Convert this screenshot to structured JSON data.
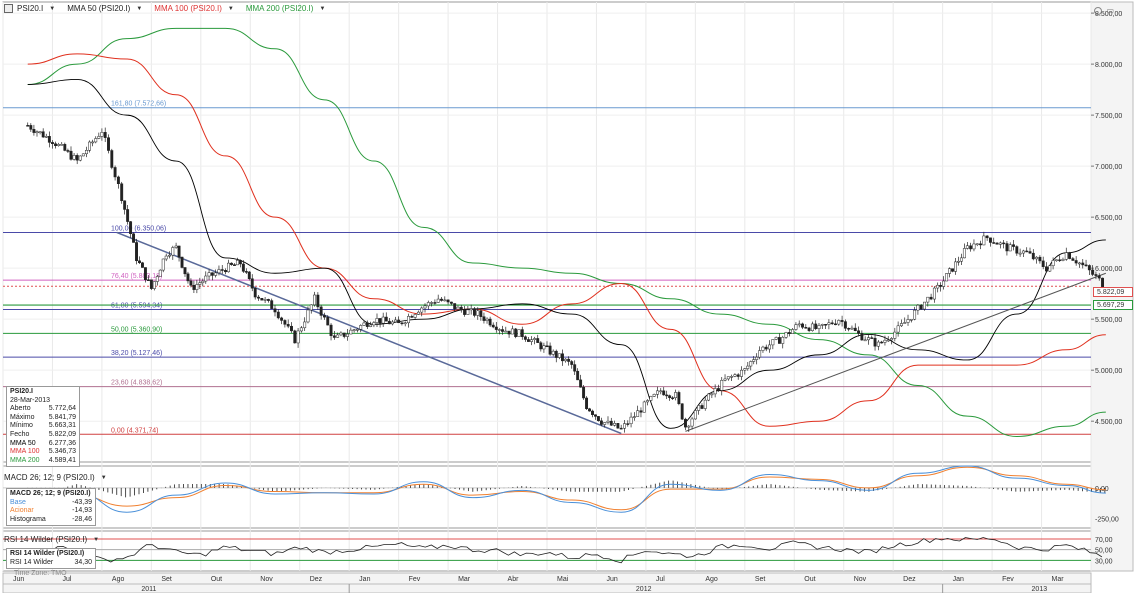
{
  "toolbar": {
    "symbol": "PSI20.I",
    "mma50": "MMA 50 (PSI20.I)",
    "mma100": "MMA 100 (PSI20.I)",
    "mma200": "MMA 200 (PSI20.I)",
    "macd": "MACD 26; 12; 9 (PSI20.I)",
    "rsi": "RSI 14 Wilder (PSI20.I)"
  },
  "colors": {
    "mma50": "#000000",
    "mma100": "#e0301e",
    "mma200": "#2a9a3c",
    "macd_base": "#4a90d9",
    "macd_signal": "#f08030",
    "fib_levels": "#4a4aa8",
    "resistance_red": "#e05050"
  },
  "info_box": {
    "title": "PSI20.I",
    "date": "28-Mar-2013",
    "rows": [
      {
        "label": "Aberto",
        "value": "5.772,64"
      },
      {
        "label": "Máximo",
        "value": "5.841,79"
      },
      {
        "label": "Mínimo",
        "value": "5.663,31"
      },
      {
        "label": "Fecho",
        "value": "5.822,09"
      },
      {
        "label": "MMA 50",
        "value": "6.277,36"
      },
      {
        "label": "MMA 100",
        "value": "5.346,73"
      },
      {
        "label": "MMA 200",
        "value": "4.589,41"
      }
    ]
  },
  "macd_box": {
    "title": "MACD 26; 12; 9 (PSI20.I)",
    "rows": [
      {
        "label": "Base",
        "value": "-43,39"
      },
      {
        "label": "Acionar",
        "value": "-14,93"
      },
      {
        "label": "Histograma",
        "value": "-28,46"
      }
    ]
  },
  "rsi_box": {
    "title": "RSI 14 Wilder (PSI20.I)",
    "rows": [
      {
        "label": "RSI 14 Wilder",
        "value": "34,30"
      }
    ]
  },
  "timezone": "Time Zone: TMO",
  "price_boxes": [
    "5.822,09",
    "5.697,29"
  ],
  "chart_data": [
    {
      "type": "candlestick",
      "title": "PSI20.I",
      "x_months": [
        "Jun",
        "Jul",
        "Ago",
        "Set",
        "Out",
        "Nov",
        "Dez",
        "Jan",
        "Fev",
        "Mar",
        "Abr",
        "Mai",
        "Jun",
        "Jul",
        "Ago",
        "Set",
        "Out",
        "Nov",
        "Dez",
        "Jan",
        "Fev",
        "Mar"
      ],
      "x_years": [
        "2011",
        "2012",
        "2013"
      ],
      "y_ticks": [
        "4.500,00",
        "5.000,00",
        "5.500,00",
        "6.000,00",
        "6.500,00",
        "7.000,00",
        "7.500,00",
        "8.000,00",
        "8.500,00"
      ],
      "ylim": [
        4100,
        8550
      ],
      "close_path": [
        [
          0,
          7400
        ],
        [
          0.5,
          7250
        ],
        [
          1,
          7050
        ],
        [
          1.5,
          7350
        ],
        [
          1.9,
          6700
        ],
        [
          2.2,
          6100
        ],
        [
          2.5,
          5800
        ],
        [
          2.8,
          6150
        ],
        [
          3.0,
          6200
        ],
        [
          3.3,
          5800
        ],
        [
          3.6,
          5900
        ],
        [
          4.0,
          6000
        ],
        [
          4.3,
          6050
        ],
        [
          4.6,
          5750
        ],
        [
          5.0,
          5600
        ],
        [
          5.4,
          5300
        ],
        [
          5.8,
          5700
        ],
        [
          6.2,
          5300
        ],
        [
          6.6,
          5400
        ],
        [
          7.0,
          5500
        ],
        [
          7.5,
          5450
        ],
        [
          7.9,
          5600
        ],
        [
          8.3,
          5700
        ],
        [
          8.7,
          5600
        ],
        [
          9.1,
          5550
        ],
        [
          9.6,
          5400
        ],
        [
          10.0,
          5350
        ],
        [
          10.5,
          5200
        ],
        [
          11.0,
          5050
        ],
        [
          11.3,
          4650
        ],
        [
          11.6,
          4500
        ],
        [
          12.0,
          4420
        ],
        [
          12.4,
          4620
        ],
        [
          12.8,
          4800
        ],
        [
          13.1,
          4750
        ],
        [
          13.3,
          4450
        ],
        [
          13.7,
          4700
        ],
        [
          14.1,
          4900
        ],
        [
          14.5,
          5000
        ],
        [
          14.8,
          5200
        ],
        [
          15.2,
          5300
        ],
        [
          15.6,
          5450
        ],
        [
          16.0,
          5400
        ],
        [
          16.4,
          5500
        ],
        [
          16.8,
          5350
        ],
        [
          17.2,
          5250
        ],
        [
          17.6,
          5400
        ],
        [
          18.0,
          5600
        ],
        [
          18.4,
          5800
        ],
        [
          18.7,
          6000
        ],
        [
          19.0,
          6200
        ],
        [
          19.4,
          6300
        ],
        [
          19.8,
          6200
        ],
        [
          20.2,
          6150
        ],
        [
          20.6,
          6000
        ],
        [
          21.0,
          6150
        ],
        [
          21.4,
          6000
        ],
        [
          21.8,
          5822
        ]
      ],
      "mma50": [
        [
          0,
          7800
        ],
        [
          1,
          7850
        ],
        [
          2,
          7500
        ],
        [
          3,
          7050
        ],
        [
          4,
          6100
        ],
        [
          5,
          5950
        ],
        [
          6,
          6000
        ],
        [
          7,
          5450
        ],
        [
          8,
          5500
        ],
        [
          9,
          5600
        ],
        [
          10,
          5650
        ],
        [
          11,
          5550
        ],
        [
          12,
          5250
        ],
        [
          13,
          4430
        ],
        [
          14,
          4800
        ],
        [
          15,
          5000
        ],
        [
          16,
          5150
        ],
        [
          17,
          5350
        ],
        [
          18,
          5200
        ],
        [
          19,
          5100
        ],
        [
          20,
          5550
        ],
        [
          21,
          6150
        ],
        [
          21.8,
          6277
        ]
      ],
      "mma100": [
        [
          0,
          8000
        ],
        [
          1,
          8100
        ],
        [
          2,
          8050
        ],
        [
          3,
          7700
        ],
        [
          4,
          7100
        ],
        [
          5,
          6500
        ],
        [
          6,
          6000
        ],
        [
          7,
          5700
        ],
        [
          8,
          5550
        ],
        [
          9,
          5600
        ],
        [
          10,
          5450
        ],
        [
          11,
          5650
        ],
        [
          12,
          5850
        ],
        [
          13,
          5400
        ],
        [
          14,
          4800
        ],
        [
          15,
          4450
        ],
        [
          16,
          4500
        ],
        [
          17,
          4700
        ],
        [
          18,
          5050
        ],
        [
          19,
          5050
        ],
        [
          20,
          5050
        ],
        [
          21,
          5200
        ],
        [
          21.8,
          5347
        ]
      ],
      "mma200": [
        [
          0,
          7800
        ],
        [
          1,
          8000
        ],
        [
          2,
          8250
        ],
        [
          3,
          8350
        ],
        [
          4,
          8350
        ],
        [
          5,
          8150
        ],
        [
          6,
          7650
        ],
        [
          7,
          7050
        ],
        [
          8,
          6400
        ],
        [
          9,
          6050
        ],
        [
          10,
          6000
        ],
        [
          11,
          5950
        ],
        [
          12,
          5850
        ],
        [
          13,
          5700
        ],
        [
          14,
          5550
        ],
        [
          15,
          5450
        ],
        [
          16,
          5300
        ],
        [
          17,
          5150
        ],
        [
          18,
          4850
        ],
        [
          19,
          4550
        ],
        [
          20,
          4350
        ],
        [
          21,
          4450
        ],
        [
          21.8,
          4589
        ]
      ],
      "fibonacci": [
        {
          "label": "161,80 (7.572,66)",
          "value": 7572.66
        },
        {
          "label": "100,00 (6.350,06)",
          "value": 6350.06
        },
        {
          "label": "76,40 (5.883,18)",
          "value": 5883.18
        },
        {
          "label": "61,80 (5.594,34)",
          "value": 5594.34
        },
        {
          "label": "50,00 (5.360,90)",
          "value": 5360.9
        },
        {
          "label": "38,20 (5.127,46)",
          "value": 5127.46
        },
        {
          "label": "23,60 (4.838,62)",
          "value": 4838.62
        },
        {
          "label": "0,00 (4.371,74)",
          "value": 4371.74
        }
      ],
      "horizontal_lines": [
        5822.09,
        5697.29
      ],
      "trendlines": [
        {
          "from": [
            1.8,
            6350
          ],
          "to": [
            12.0,
            4380
          ]
        },
        {
          "from": [
            13.3,
            4400
          ],
          "to": [
            21.8,
            5950
          ]
        }
      ]
    },
    {
      "type": "line",
      "title": "MACD 26; 12; 9 (PSI20.I)",
      "y_ticks": [
        "0,00",
        "-250,00"
      ],
      "ylim": [
        -330,
        180
      ],
      "series": [
        {
          "name": "Base",
          "values": [
            [
              0,
              -150
            ],
            [
              1,
              -40
            ],
            [
              2,
              -200
            ],
            [
              3,
              -60
            ],
            [
              4,
              40
            ],
            [
              5,
              -50
            ],
            [
              6,
              -40
            ],
            [
              7,
              -50
            ],
            [
              8,
              50
            ],
            [
              9,
              -80
            ],
            [
              10,
              -20
            ],
            [
              11,
              -120
            ],
            [
              12,
              -200
            ],
            [
              13,
              30
            ],
            [
              14,
              -20
            ],
            [
              15,
              110
            ],
            [
              16,
              60
            ],
            [
              17,
              -20
            ],
            [
              18,
              120
            ],
            [
              19,
              180
            ],
            [
              20,
              80
            ],
            [
              21,
              20
            ],
            [
              21.8,
              -43
            ]
          ]
        },
        {
          "name": "Acionar",
          "values": [
            [
              0,
              -100
            ],
            [
              1,
              -60
            ],
            [
              2,
              -150
            ],
            [
              3,
              -80
            ],
            [
              4,
              20
            ],
            [
              5,
              -30
            ],
            [
              6,
              -40
            ],
            [
              7,
              -40
            ],
            [
              8,
              30
            ],
            [
              9,
              -60
            ],
            [
              10,
              -30
            ],
            [
              11,
              -100
            ],
            [
              12,
              -180
            ],
            [
              13,
              -10
            ],
            [
              14,
              -10
            ],
            [
              15,
              90
            ],
            [
              16,
              70
            ],
            [
              17,
              0
            ],
            [
              18,
              100
            ],
            [
              19,
              170
            ],
            [
              20,
              100
            ],
            [
              21,
              30
            ],
            [
              21.8,
              -15
            ]
          ]
        }
      ]
    },
    {
      "type": "line",
      "title": "RSI 14 Wilder (PSI20.I)",
      "y_ticks": [
        "70,00",
        "50,00",
        "30,00"
      ],
      "ylim": [
        10,
        85
      ],
      "series": [
        {
          "name": "RSI 14 Wilder",
          "values": [
            [
              0,
              40
            ],
            [
              0.7,
              55
            ],
            [
              1.5,
              30
            ],
            [
              2,
              35
            ],
            [
              2.5,
              60
            ],
            [
              3,
              45
            ],
            [
              3.5,
              40
            ],
            [
              4,
              55
            ],
            [
              4.5,
              48
            ],
            [
              5,
              42
            ],
            [
              5.5,
              55
            ],
            [
              6,
              45
            ],
            [
              6.5,
              50
            ],
            [
              7,
              55
            ],
            [
              7.5,
              60
            ],
            [
              8,
              52
            ],
            [
              8.5,
              58
            ],
            [
              9,
              50
            ],
            [
              9.5,
              48
            ],
            [
              10,
              40
            ],
            [
              10.5,
              45
            ],
            [
              11,
              35
            ],
            [
              11.5,
              42
            ],
            [
              12,
              30
            ],
            [
              12.5,
              50
            ],
            [
              13,
              42
            ],
            [
              13.5,
              38
            ],
            [
              14,
              55
            ],
            [
              14.5,
              60
            ],
            [
              15,
              52
            ],
            [
              15.5,
              62
            ],
            [
              16,
              55
            ],
            [
              16.5,
              50
            ],
            [
              17,
              45
            ],
            [
              17.5,
              58
            ],
            [
              18,
              65
            ],
            [
              18.5,
              72
            ],
            [
              19,
              68
            ],
            [
              19.5,
              72
            ],
            [
              20,
              55
            ],
            [
              20.5,
              50
            ],
            [
              21,
              58
            ],
            [
              21.5,
              45
            ],
            [
              21.8,
              34.3
            ]
          ]
        }
      ],
      "levels": [
        70,
        50,
        30
      ]
    }
  ]
}
